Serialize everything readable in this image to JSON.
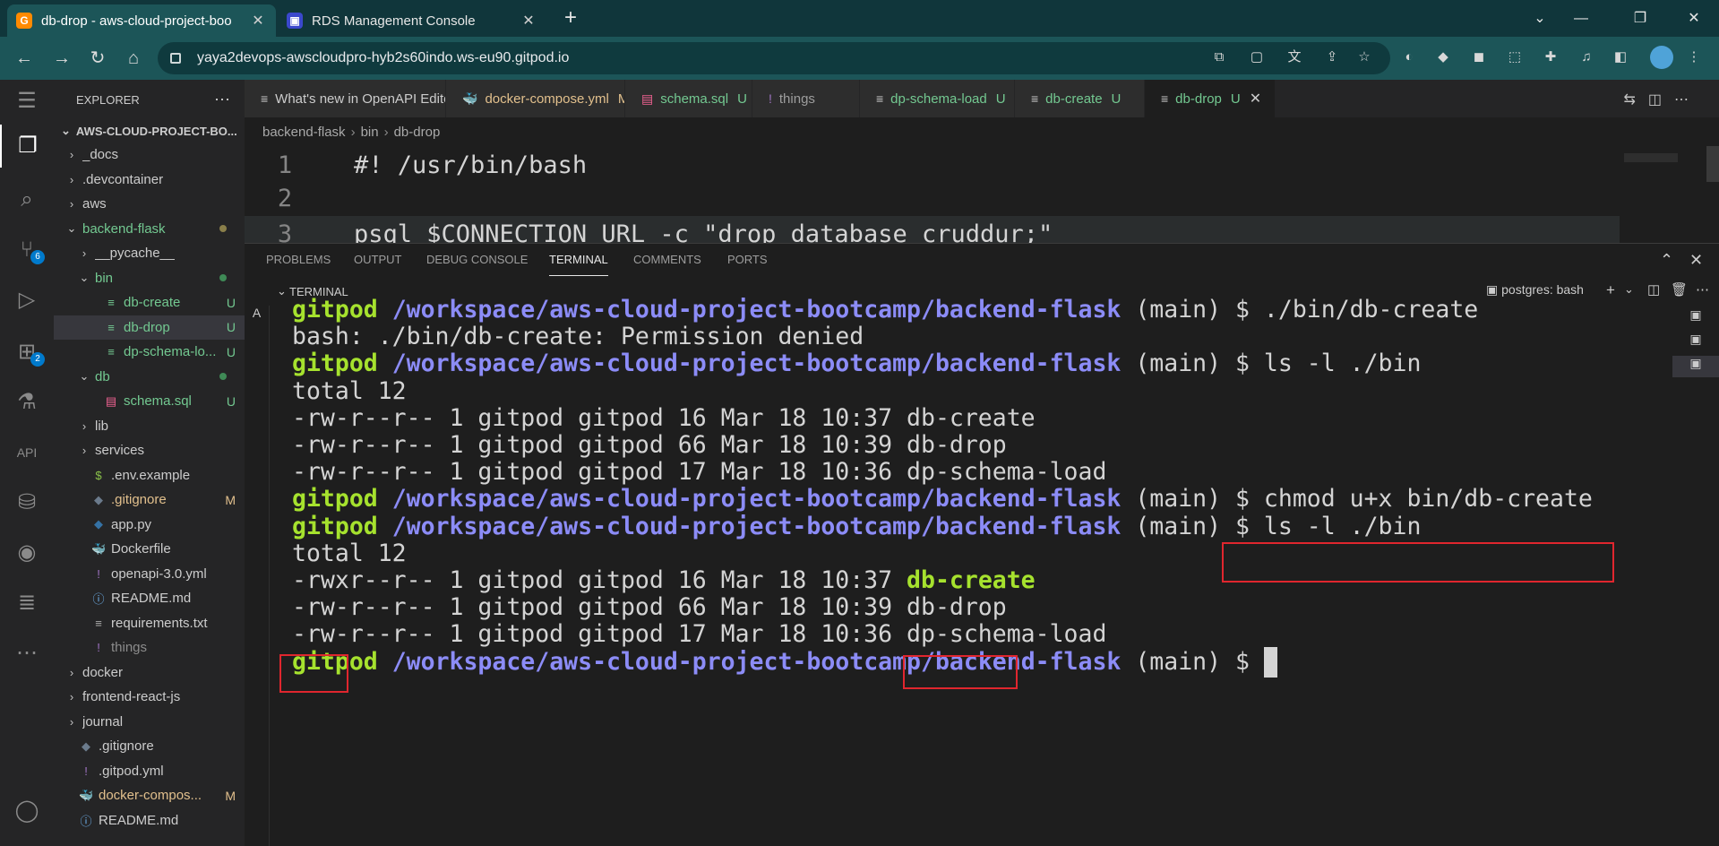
{
  "browser": {
    "tabs": [
      {
        "title": "db-drop - aws-cloud-project-boo",
        "active": true
      },
      {
        "title": "RDS Management Console",
        "active": false
      }
    ],
    "url": "yaya2devops-awscloudpro-hyb2s60indo.ws-eu90.gitpod.io"
  },
  "activity_bar": {
    "icons": [
      "menu-icon",
      "explorer-icon",
      "search-icon",
      "source-control-icon",
      "run-debug-icon",
      "extensions-icon",
      "testing-icon",
      "openapi-icon",
      "database-icon",
      "github-icon",
      "docker-icon",
      "more-icon",
      "account-icon"
    ],
    "source_control_badge": "6",
    "extensions_badge": "2"
  },
  "explorer": {
    "title": "EXPLORER",
    "workspace": "AWS-CLOUD-PROJECT-BO...",
    "items": [
      {
        "label": "_docs",
        "type": "folder",
        "open": false,
        "depth": 1,
        "status": ""
      },
      {
        "label": ".devcontainer",
        "type": "folder",
        "open": false,
        "depth": 1,
        "status": ""
      },
      {
        "label": "aws",
        "type": "folder",
        "open": false,
        "depth": 1,
        "status": ""
      },
      {
        "label": "backend-flask",
        "type": "folder",
        "open": true,
        "depth": 1,
        "status": "dot-olive"
      },
      {
        "label": "__pycache__",
        "type": "folder",
        "open": false,
        "depth": 2,
        "status": ""
      },
      {
        "label": "bin",
        "type": "folder",
        "open": true,
        "depth": 2,
        "status": "dot-green"
      },
      {
        "label": "db-create",
        "type": "file",
        "depth": 3,
        "status": "U"
      },
      {
        "label": "db-drop",
        "type": "file",
        "depth": 3,
        "status": "U",
        "selected": true
      },
      {
        "label": "dp-schema-lo...",
        "type": "file",
        "depth": 3,
        "status": "U"
      },
      {
        "label": "db",
        "type": "folder",
        "open": true,
        "depth": 2,
        "status": "dot-green"
      },
      {
        "label": "schema.sql",
        "type": "sql",
        "depth": 3,
        "status": "U"
      },
      {
        "label": "lib",
        "type": "folder",
        "open": false,
        "depth": 2,
        "status": ""
      },
      {
        "label": "services",
        "type": "folder",
        "open": false,
        "depth": 2,
        "status": ""
      },
      {
        "label": ".env.example",
        "type": "env",
        "depth": 2,
        "status": ""
      },
      {
        "label": ".gitignore",
        "type": "git",
        "depth": 2,
        "status": "M"
      },
      {
        "label": "app.py",
        "type": "py",
        "depth": 2,
        "status": ""
      },
      {
        "label": "Dockerfile",
        "type": "docker",
        "depth": 2,
        "status": ""
      },
      {
        "label": "openapi-3.0.yml",
        "type": "yml",
        "depth": 2,
        "status": ""
      },
      {
        "label": "README.md",
        "type": "info",
        "depth": 2,
        "status": ""
      },
      {
        "label": "requirements.txt",
        "type": "txt",
        "depth": 2,
        "status": ""
      },
      {
        "label": "things",
        "type": "yml",
        "depth": 2,
        "status": "",
        "dim": true
      },
      {
        "label": "docker",
        "type": "folder",
        "open": false,
        "depth": 1,
        "status": ""
      },
      {
        "label": "frontend-react-js",
        "type": "folder",
        "open": false,
        "depth": 1,
        "status": ""
      },
      {
        "label": "journal",
        "type": "folder",
        "open": false,
        "depth": 1,
        "status": ""
      },
      {
        "label": ".gitignore",
        "type": "git",
        "depth": 1,
        "status": ""
      },
      {
        "label": ".gitpod.yml",
        "type": "yml",
        "depth": 1,
        "status": ""
      },
      {
        "label": "docker-compos...",
        "type": "docker",
        "depth": 1,
        "status": "M",
        "modified": true
      },
      {
        "label": "README.md",
        "type": "info",
        "depth": 1,
        "status": ""
      }
    ]
  },
  "editor": {
    "tabs": [
      {
        "label": "What's new in OpenAPI Editor",
        "status": "",
        "icon": "≡",
        "color": "#cccccc"
      },
      {
        "label": "docker-compose.yml",
        "status": "M",
        "icon": "🐳",
        "color": "#e2c08d"
      },
      {
        "label": "schema.sql",
        "status": "U",
        "icon": "▤",
        "color": "#73c991"
      },
      {
        "label": "things",
        "status": "",
        "icon": "!",
        "color": "#9d9d9d"
      },
      {
        "label": "dp-schema-load",
        "status": "U",
        "icon": "≡",
        "color": "#73c991"
      },
      {
        "label": "db-create",
        "status": "U",
        "icon": "≡",
        "color": "#73c991"
      },
      {
        "label": "db-drop",
        "status": "U",
        "icon": "≡",
        "color": "#73c991",
        "active": true
      }
    ],
    "breadcrumb": [
      "backend-flask",
      "bin",
      "db-drop"
    ],
    "lines": [
      {
        "n": "1",
        "text": "#! /usr/bin/bash"
      },
      {
        "n": "2",
        "text": ""
      },
      {
        "n": "3",
        "text": "psql $CONNECTION_URL -c \"drop database cruddur;\""
      }
    ]
  },
  "panel": {
    "tabs": [
      "PROBLEMS",
      "OUTPUT",
      "DEBUG CONSOLE",
      "TERMINAL",
      "COMMENTS",
      "PORTS"
    ],
    "active_tab": "TERMINAL",
    "terminal_label": "TERMINAL",
    "instance": "postgres: bash"
  },
  "terminal": {
    "user": "gitpod",
    "path": "/workspace/aws-cloud-project-bootcamp/backend-flask",
    "branch": " (main) $ ",
    "lines": [
      {
        "kind": "prompt",
        "cmd": "./bin/db-create"
      },
      {
        "kind": "out",
        "text": "bash: ./bin/db-create: Permission denied"
      },
      {
        "kind": "prompt",
        "cmd": "ls -l ./bin"
      },
      {
        "kind": "out",
        "text": "total 12"
      },
      {
        "kind": "out",
        "text": "-rw-r--r-- 1 gitpod gitpod 16 Mar 18 10:37 db-create"
      },
      {
        "kind": "out",
        "text": "-rw-r--r-- 1 gitpod gitpod 66 Mar 18 10:39 db-drop"
      },
      {
        "kind": "out",
        "text": "-rw-r--r-- 1 gitpod gitpod 17 Mar 18 10:36 dp-schema-load"
      },
      {
        "kind": "prompt",
        "cmd": "chmod u+x bin/db-create"
      },
      {
        "kind": "prompt",
        "cmd": "ls -l ./bin"
      },
      {
        "kind": "out",
        "text": "total 12"
      },
      {
        "kind": "outhl",
        "text": "-rwxr--r-- 1 gitpod gitpod 16 Mar 18 10:37 ",
        "hl": "db-create"
      },
      {
        "kind": "out",
        "text": "-rw-r--r-- 1 gitpod gitpod 66 Mar 18 10:39 db-drop"
      },
      {
        "kind": "out",
        "text": "-rw-r--r-- 1 gitpod gitpod 17 Mar 18 10:36 dp-schema-load"
      },
      {
        "kind": "prompt",
        "cmd": "",
        "cursor": true
      }
    ]
  },
  "colors": {
    "prompt_user": "#a6e22e",
    "prompt_path": "#8c8cf7",
    "annotation_box": "#e0262e",
    "untracked": "#73c991",
    "modified": "#e2c08d"
  }
}
